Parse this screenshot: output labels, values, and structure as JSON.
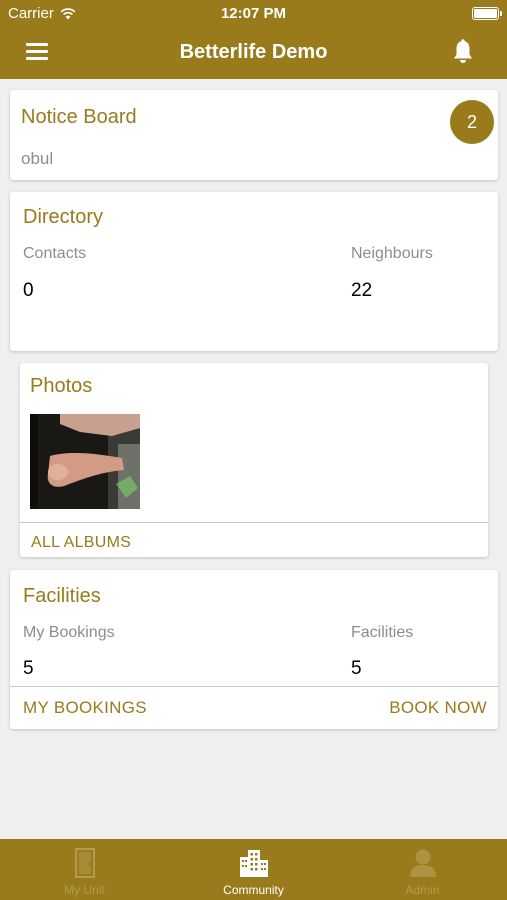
{
  "status_bar": {
    "carrier": "Carrier",
    "time": "12:07 PM"
  },
  "header": {
    "title": "Betterlife Demo"
  },
  "notice_board": {
    "title": "Notice Board",
    "subtitle": "obul",
    "badge_count": "2"
  },
  "directory": {
    "title": "Directory",
    "contacts_label": "Contacts",
    "contacts_value": "0",
    "neighbours_label": "Neighbours",
    "neighbours_value": "22"
  },
  "photos": {
    "title": "Photos",
    "all_albums_label": "ALL ALBUMS"
  },
  "facilities": {
    "title": "Facilities",
    "my_bookings_label": "My Bookings",
    "my_bookings_value": "5",
    "facilities_label": "Facilities",
    "facilities_value": "5",
    "my_bookings_link": "MY BOOKINGS",
    "book_now_link": "BOOK NOW"
  },
  "tabbar": {
    "tabs": [
      {
        "label": "My Unit",
        "icon": "door-icon",
        "active": false
      },
      {
        "label": "Community",
        "icon": "buildings-icon",
        "active": true
      },
      {
        "label": "Admin",
        "icon": "person-icon",
        "active": false
      }
    ]
  },
  "colors": {
    "brand": "#9a7b1c",
    "background": "#efeff0",
    "muted_text": "#8d8d8d"
  }
}
